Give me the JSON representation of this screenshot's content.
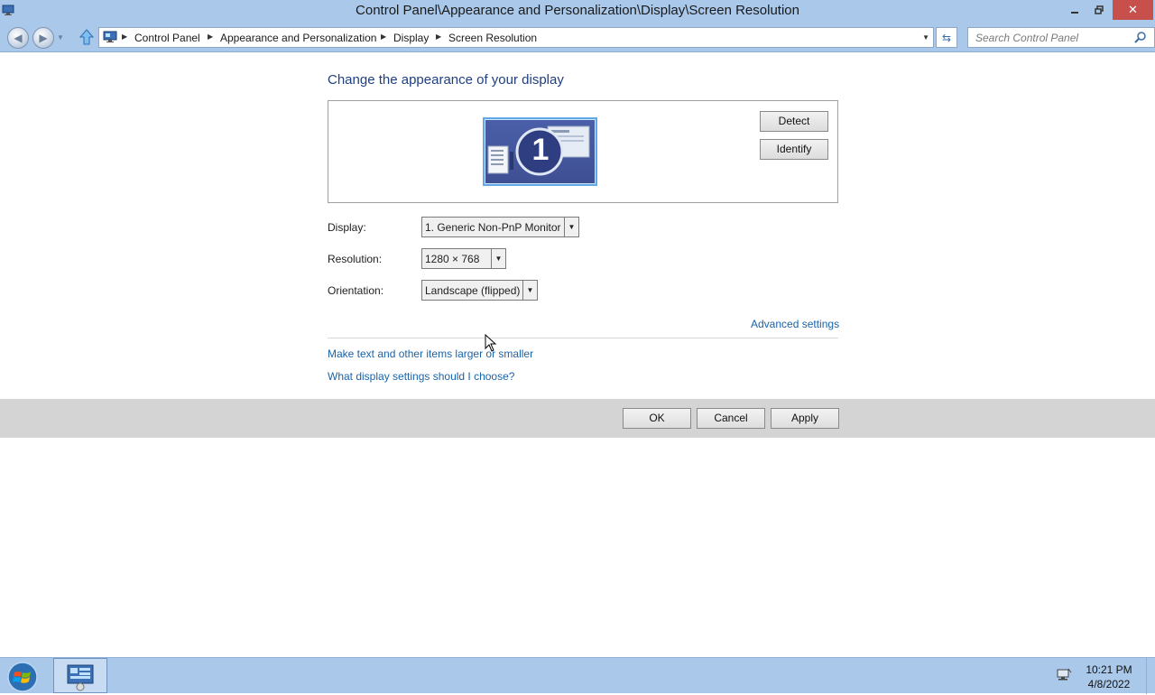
{
  "window": {
    "title": "Control Panel\\Appearance and Personalization\\Display\\Screen Resolution",
    "minimize_icon": "minimize-icon",
    "restore_icon": "restore-icon",
    "close_glyph": "✕"
  },
  "address_bar": {
    "breadcrumbs": [
      "Control Panel",
      "Appearance and Personalization",
      "Display",
      "Screen Resolution"
    ],
    "search_placeholder": "Search Control Panel"
  },
  "content": {
    "heading": "Change the appearance of your display",
    "monitor_number": "1",
    "detect_label": "Detect",
    "identify_label": "Identify",
    "display_label": "Display:",
    "display_value": "1. Generic Non-PnP Monitor",
    "resolution_label": "Resolution:",
    "resolution_value": "1280 × 768",
    "orientation_label": "Orientation:",
    "orientation_value": "Landscape (flipped)",
    "advanced_link": "Advanced settings",
    "text_size_link": "Make text and other items larger or smaller",
    "help_link": "What display settings should I choose?"
  },
  "footer": {
    "ok_label": "OK",
    "cancel_label": "Cancel",
    "apply_label": "Apply"
  },
  "taskbar": {
    "time": "10:21 PM",
    "date": "4/8/2022"
  },
  "colors": {
    "titlebar": "#a9c8ea",
    "heading": "#1e3f80",
    "link": "#1a63a8",
    "close_button": "#c7504d",
    "footer_band": "#d4d4d4"
  }
}
